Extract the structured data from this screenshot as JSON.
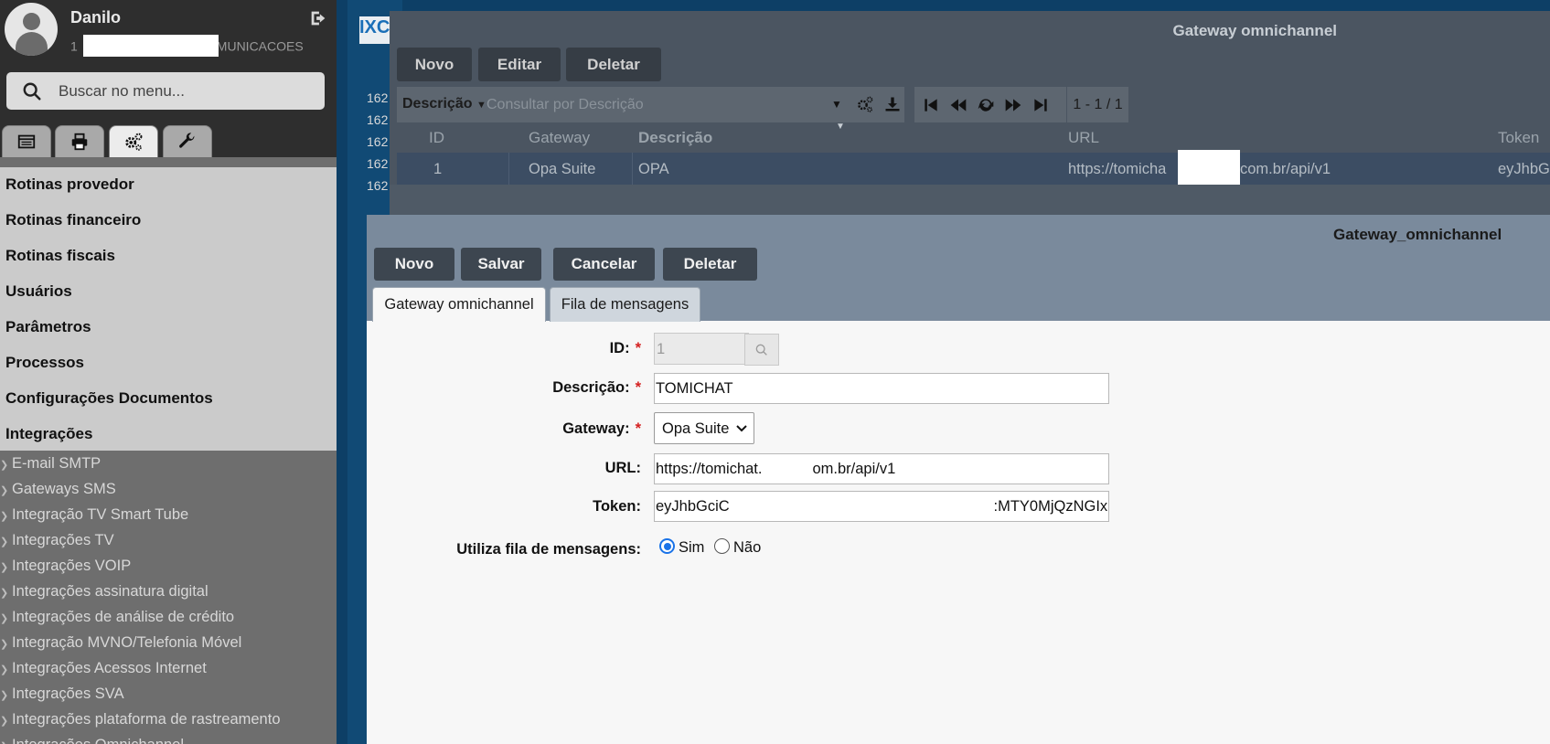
{
  "sidebar": {
    "user_name": "Danilo",
    "company_prefix": "1",
    "company_suffix": "MUNICACOES",
    "search_placeholder": "Buscar no menu...",
    "tabs": [
      "list-icon",
      "print-icon",
      "gears-icon",
      "wrench-icon"
    ],
    "menu": [
      "Rotinas provedor",
      "Rotinas financeiro",
      "Rotinas fiscais",
      "Usuários",
      "Parâmetros",
      "Processos",
      "Configurações Documentos",
      "Integrações"
    ],
    "submenu": [
      "E-mail SMTP",
      "Gateways SMS",
      "Integração TV Smart Tube",
      "Integrações TV",
      "Integrações VOIP",
      "Integrações assinatura digital",
      "Integrações de análise de crédito",
      "Integração MVNO/Telefonia Móvel",
      "Integrações Acessos Internet",
      "Integrações SVA",
      "Integrações plataforma de rastreamento",
      "Integrações Omnichannel"
    ]
  },
  "background": {
    "logo": "IXC",
    "numbers": [
      "162",
      "162",
      "162",
      "162",
      "162"
    ]
  },
  "list_window": {
    "title": "Gateway omnichannel",
    "buttons": {
      "new": "Novo",
      "edit": "Editar",
      "delete": "Deletar"
    },
    "filter": {
      "field": "Descrição",
      "placeholder": "Consultar por Descrição"
    },
    "pager": "1 - 1 / 1",
    "columns": {
      "id": "ID",
      "gateway": "Gateway",
      "description": "Descrição",
      "url": "URL",
      "token": "Token"
    },
    "row": {
      "id": "1",
      "gateway": "Opa Suite",
      "description": "OPA",
      "url_start": "https://tomicha",
      "url_end": "com.br/api/v1",
      "token": "eyJhbGc"
    }
  },
  "form_window": {
    "title": "Gateway_omnichannel",
    "buttons": {
      "new": "Novo",
      "save": "Salvar",
      "cancel": "Cancelar",
      "delete": "Deletar"
    },
    "tabs": {
      "main": "Gateway omnichannel",
      "queue": "Fila de mensagens"
    },
    "labels": {
      "id": "ID:",
      "description": "Descrição:",
      "gateway": "Gateway:",
      "url": "URL:",
      "token": "Token:",
      "use_queue": "Utiliza fila de mensagens:"
    },
    "required_mark": "*",
    "values": {
      "id": "1",
      "description": "TOMICHAT",
      "gateway": "Opa Suite",
      "url": "https://tomichat.            om.br/api/v1",
      "token": "eyJhbGciC                                                               :MTY0MjQzNGIx"
    },
    "radio": {
      "yes": "Sim",
      "no": "Não",
      "selected": "Sim"
    }
  }
}
